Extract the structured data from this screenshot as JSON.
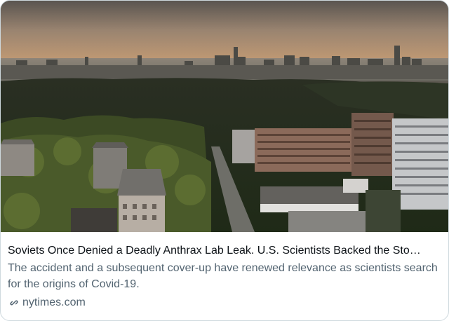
{
  "card": {
    "image": {
      "description": "",
      "icon": "photo-thumbnail"
    },
    "headline": "Soviets Once Denied a Deadly Anthrax Lab Leak. U.S. Scientists Backed the Sto…",
    "description": "The accident and a subsequent cover-up have renewed relevance as scientists search for the origins of Covid-19.",
    "source": {
      "icon": "link-icon",
      "domain": "nytimes.com"
    }
  },
  "colors": {
    "headline": "#0f1419",
    "secondary_text": "#536471",
    "border": "#cfd9de"
  }
}
